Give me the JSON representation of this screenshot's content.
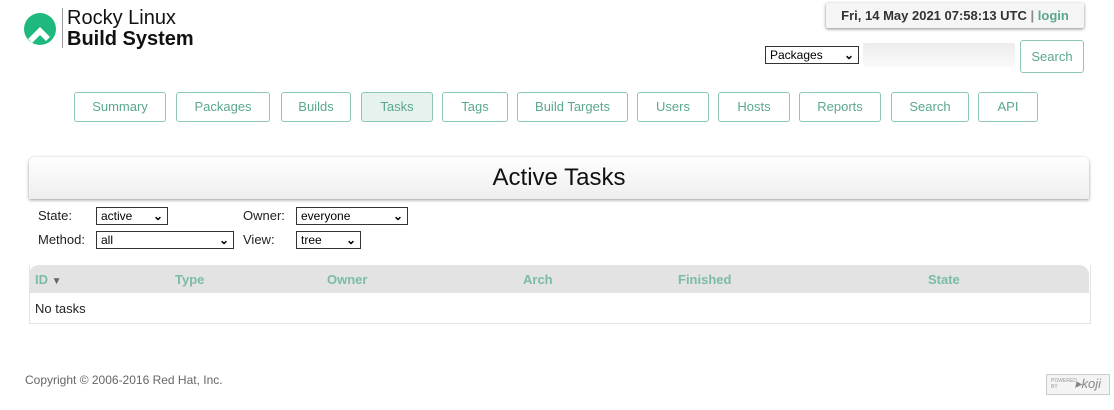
{
  "header": {
    "logo_line1": "Rocky Linux",
    "logo_line2": "Build System",
    "datetime": "Fri, 14 May 2021 07:58:13 UTC",
    "separator": "|",
    "login": "login",
    "search_type": "Packages",
    "search_placeholder": "",
    "search_button": "Search"
  },
  "nav": [
    {
      "label": "Summary"
    },
    {
      "label": "Packages"
    },
    {
      "label": "Builds"
    },
    {
      "label": "Tasks",
      "active": true
    },
    {
      "label": "Tags"
    },
    {
      "label": "Build Targets"
    },
    {
      "label": "Users"
    },
    {
      "label": "Hosts"
    },
    {
      "label": "Reports"
    },
    {
      "label": "Search"
    },
    {
      "label": "API"
    }
  ],
  "page_title": "Active Tasks",
  "filters": {
    "state_label": "State:",
    "state": "active",
    "owner_label": "Owner:",
    "owner": "everyone",
    "method_label": "Method:",
    "method": "all",
    "view_label": "View:",
    "view": "tree"
  },
  "table": {
    "columns": [
      "ID",
      "Type",
      "Owner",
      "Arch",
      "Finished",
      "State"
    ],
    "sort_indicator": "▼",
    "empty": "No tasks"
  },
  "footer": {
    "copyright": "Copyright © 2006-2016 Red Hat, Inc.",
    "badge": "POWERED BY koji"
  },
  "colors": {
    "accent": "#5aa88b",
    "logo": "#1fb980"
  }
}
